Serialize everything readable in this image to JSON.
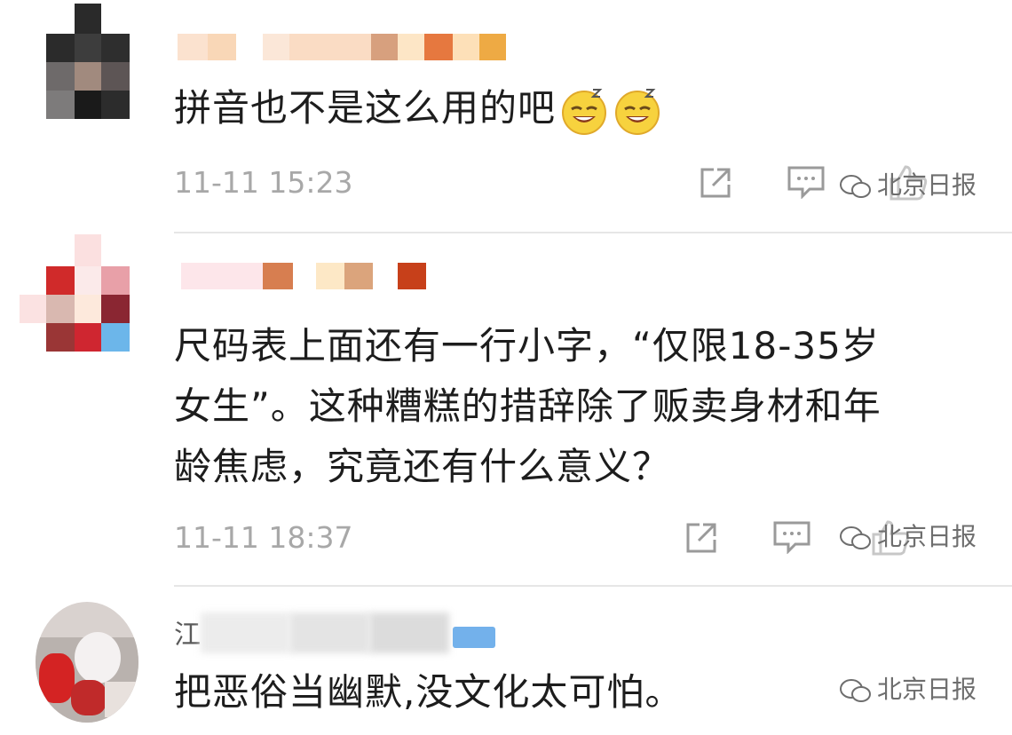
{
  "comments": [
    {
      "text": "拼音也不是这么用的吧",
      "emojis": [
        "sleepy-grin-emoji",
        "sleepy-grin-emoji"
      ],
      "time": "11-11 15:23",
      "watermark": "北京日报"
    },
    {
      "text_lines": [
        "尺码表上面还有一行小字，“仅限18-35岁",
        "女生”。这种糟糕的措辞除了贩卖身材和年",
        "龄焦虑，究竟还有什么意义？"
      ],
      "time": "11-11 18:37",
      "watermark": "北京日报"
    },
    {
      "name_initial": "江",
      "text": "把恶俗当幽默,没文化太可怕。",
      "watermark": "北京日报"
    }
  ],
  "icons": {
    "share": "share-icon",
    "comment": "comment-icon",
    "like": "like-icon"
  },
  "colors": {
    "time_gray": "#a8a8a8",
    "icon_gray": "#9a9a9a",
    "divider": "#e6e6e6"
  }
}
